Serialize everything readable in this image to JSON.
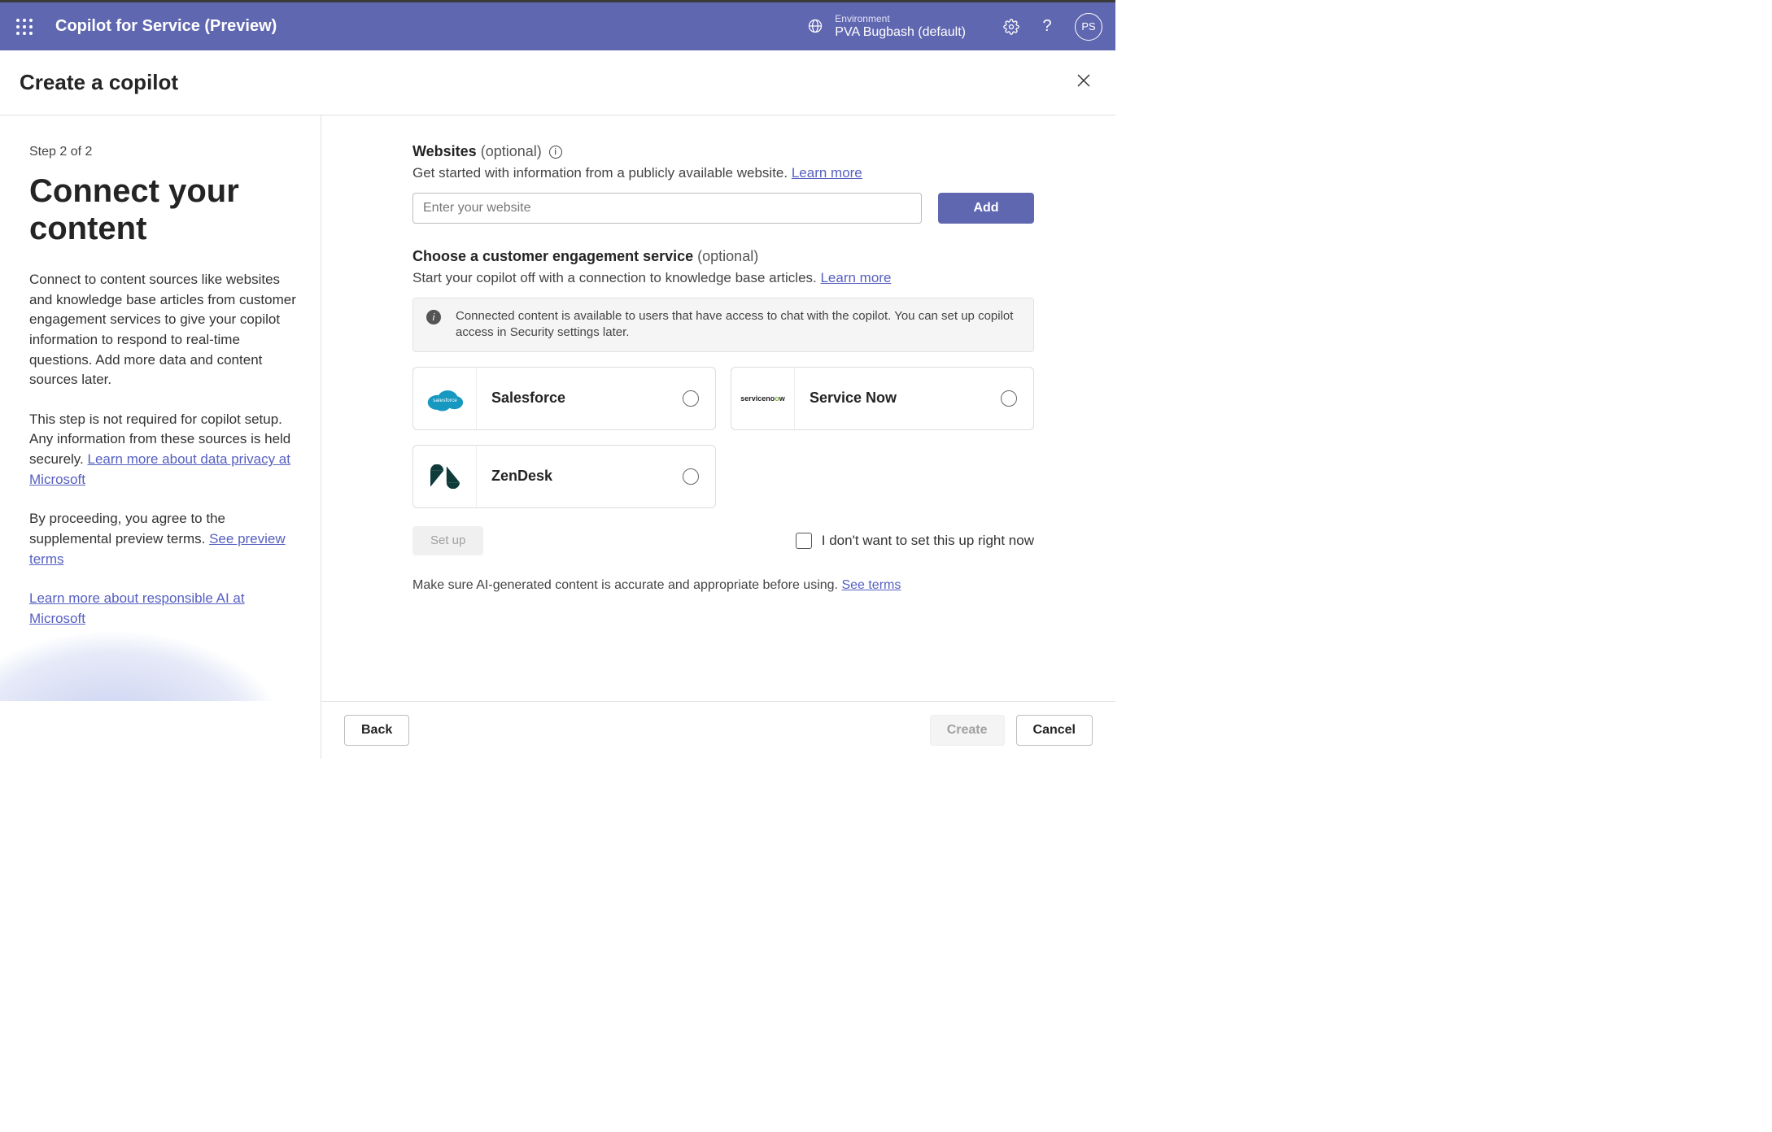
{
  "topbar": {
    "app_title": "Copilot for Service (Preview)",
    "env_label": "Environment",
    "env_name": "PVA Bugbash (default)",
    "avatar_initials": "PS"
  },
  "page": {
    "header_title": "Create a copilot"
  },
  "sidebar": {
    "step": "Step 2 of 2",
    "heading": "Connect your content",
    "p1": "Connect to content sources like websites and knowledge base articles from customer engagement services to give your copilot information to respond to real-time questions. Add more data and content sources later.",
    "p2_pre": "This step is not required for copilot setup. Any information from these sources is held securely. ",
    "p2_link": "Learn more about data privacy at Microsoft",
    "p3_pre": "By proceeding, you agree to the supplemental preview terms. ",
    "p3_link": "See preview terms",
    "p4_link": "Learn more about responsible AI at Microsoft"
  },
  "content": {
    "websites": {
      "label_bold": "Websites",
      "label_opt": "(optional)",
      "sub_pre": "Get started with information from a publicly available website. ",
      "sub_link": "Learn more",
      "placeholder": "Enter your website",
      "add_btn": "Add"
    },
    "service": {
      "label_bold": "Choose a customer engagement service",
      "label_opt": "(optional)",
      "sub_pre": "Start your copilot off with a connection to knowledge base articles. ",
      "sub_link": "Learn more",
      "banner": "Connected content is available to users that have access to chat with the copilot. You can set up copilot access in Security settings later.",
      "cards": [
        {
          "name": "Salesforce"
        },
        {
          "name": "Service Now"
        },
        {
          "name": "ZenDesk"
        }
      ],
      "setup_btn": "Set up",
      "skip_label": "I don't want to set this up right now"
    },
    "terms_pre": "Make sure AI-generated content is accurate and appropriate before using. ",
    "terms_link": "See terms"
  },
  "footer": {
    "back": "Back",
    "create": "Create",
    "cancel": "Cancel"
  }
}
